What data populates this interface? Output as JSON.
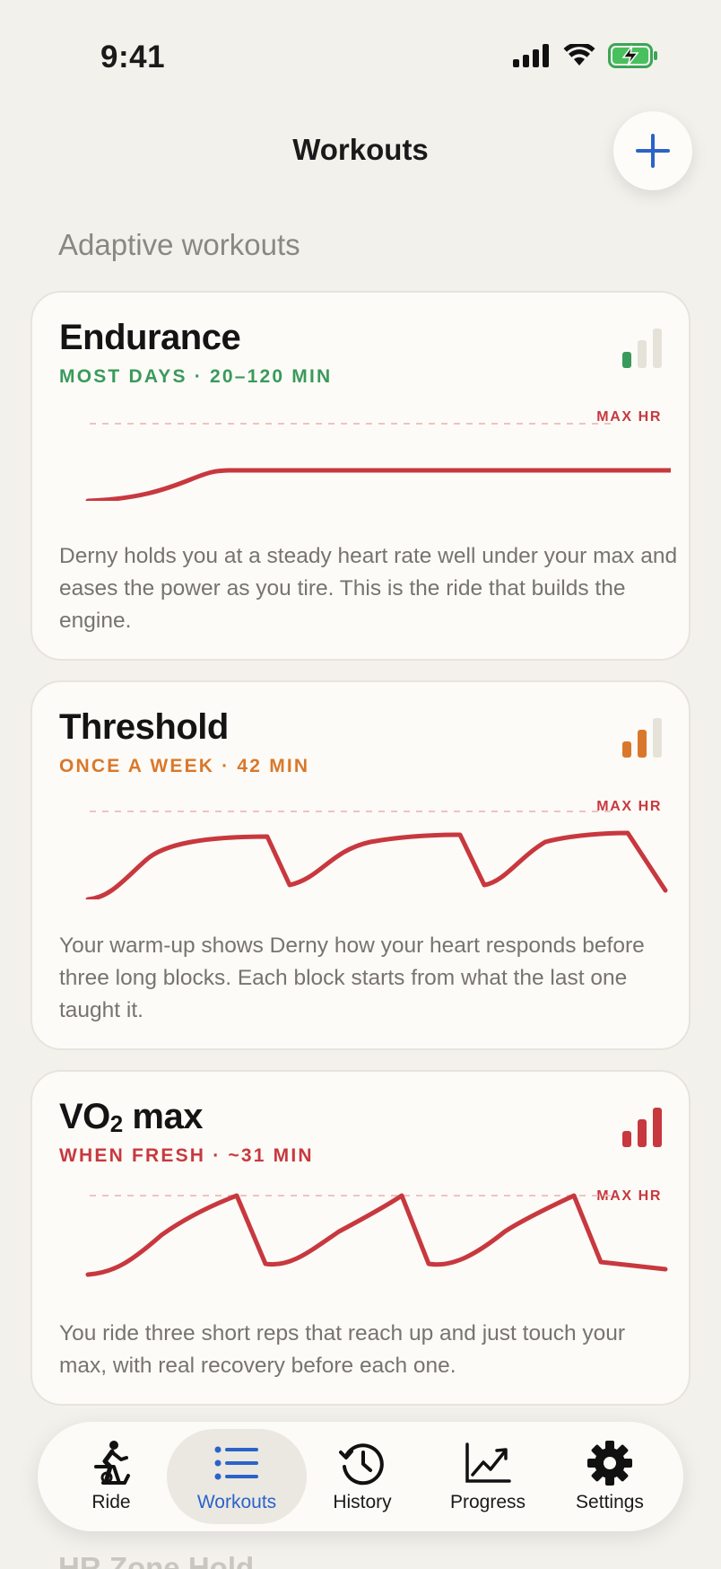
{
  "status_bar": {
    "time": "9:41",
    "icons": [
      "cellular-signal-icon",
      "wifi-icon",
      "battery-charging-icon"
    ]
  },
  "header": {
    "title": "Workouts",
    "add_button_icon": "plus-icon"
  },
  "section": {
    "title": "Adaptive workouts"
  },
  "workouts": [
    {
      "title": "Endurance",
      "subtitle": "MOST DAYS · 20–120 MIN",
      "accent": "#3a9a5b",
      "intensity_bars_filled": 1,
      "max_hr_label": "MAX HR",
      "description": "Derny holds you at a steady heart rate well under your max and eases the power as you tire. This is the ride that builds the engine."
    },
    {
      "title": "Threshold",
      "subtitle": "ONCE A WEEK · 42 MIN",
      "accent": "#d9782b",
      "intensity_bars_filled": 2,
      "max_hr_label": "MAX HR",
      "description": "Your warm-up shows Derny how your heart responds before three long blocks. Each block starts from what the last one taught it."
    },
    {
      "title_main": "VO",
      "title_sub": "2",
      "title_rest": " max",
      "subtitle": "WHEN FRESH · ~31 MIN",
      "accent": "#c8383f",
      "intensity_bars_filled": 3,
      "max_hr_label": "MAX HR",
      "description": "You ride three short reps that reach up and just touch your max, with real recovery before each one."
    }
  ],
  "next_card_peek": "HR Zone Hold",
  "tabs": [
    {
      "label": "Ride",
      "icon": "cyclist-icon",
      "active": false
    },
    {
      "label": "Workouts",
      "icon": "list-icon",
      "active": true
    },
    {
      "label": "History",
      "icon": "history-clock-icon",
      "active": false
    },
    {
      "label": "Progress",
      "icon": "trend-chart-icon",
      "active": false
    },
    {
      "label": "Settings",
      "icon": "gear-icon",
      "active": false
    }
  ],
  "colors": {
    "hr_line": "#c8383f",
    "max_hr_dash": "#efc2c2",
    "active_tab": "#2b63c9",
    "background": "#f3f1ec"
  }
}
